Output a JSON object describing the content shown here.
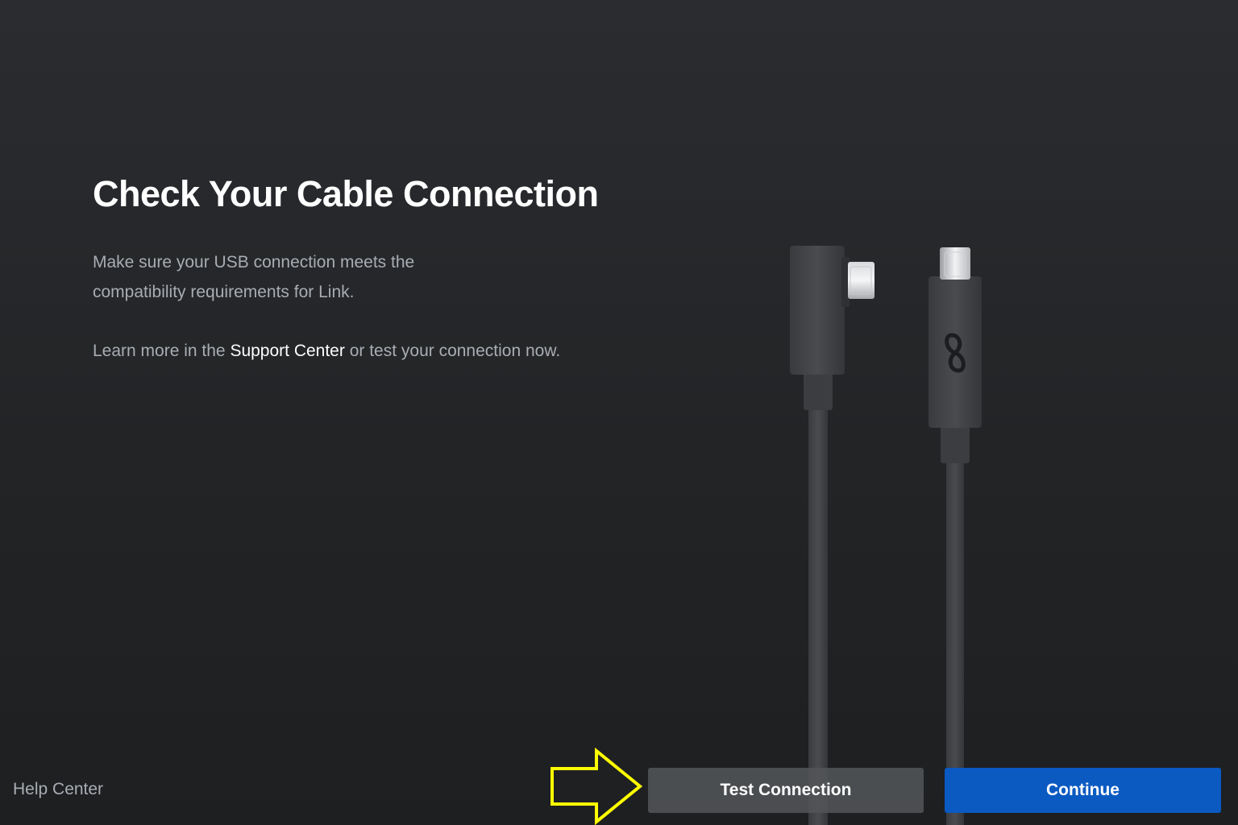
{
  "main": {
    "title": "Check Your Cable Connection",
    "description": "Make sure your USB connection meets the compatibility requirements for Link.",
    "learn_prefix": "Learn more in the ",
    "learn_link": "Support Center",
    "learn_suffix": " or test your connection now."
  },
  "footer": {
    "help_link": "Help Center",
    "test_button": "Test Connection",
    "continue_button": "Continue"
  },
  "colors": {
    "background": "#222426",
    "primary_button": "#0a5ac2",
    "secondary_button": "#525458",
    "highlight_arrow": "#ffff00"
  },
  "icons": {
    "arrow": "arrow-right-outline-icon",
    "logo": "meta-logo-icon"
  }
}
